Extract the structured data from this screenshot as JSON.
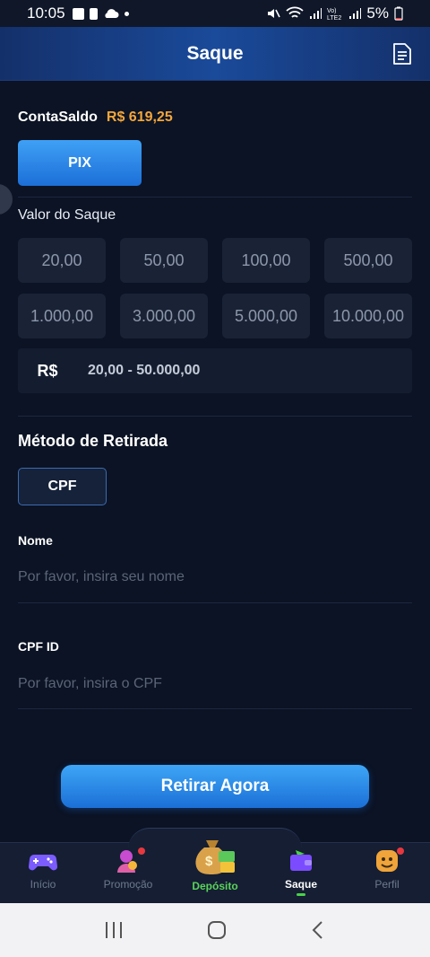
{
  "status_bar": {
    "time": "10:05",
    "battery": "5%"
  },
  "header": {
    "title": "Saque"
  },
  "balance": {
    "label": "ContaSaldo",
    "value": "R$ 619,25"
  },
  "method_tab": {
    "label": "PIX"
  },
  "amount_section": {
    "label": "Valor do Saque",
    "options": [
      "20,00",
      "50,00",
      "100,00",
      "500,00",
      "1.000,00",
      "3.000,00",
      "5.000,00",
      "10.000,00"
    ],
    "currency": "R$",
    "range": "20,00 - 50.000,00"
  },
  "withdraw_method": {
    "title": "Método de Retirada",
    "option": "CPF"
  },
  "form": {
    "name_label": "Nome",
    "name_placeholder": "Por favor, insira seu nome",
    "cpf_label": "CPF ID",
    "cpf_placeholder": "Por favor, insira o CPF"
  },
  "submit": {
    "label": "Retirar Agora"
  },
  "bottom_nav": {
    "items": [
      {
        "label": "Início"
      },
      {
        "label": "Promoção"
      },
      {
        "label": "Depósito"
      },
      {
        "label": "Saque"
      },
      {
        "label": "Perfil"
      }
    ]
  },
  "colors": {
    "accent_blue": "#1c6fd8",
    "balance_orange": "#f4a63a",
    "active_green": "#49d249"
  }
}
